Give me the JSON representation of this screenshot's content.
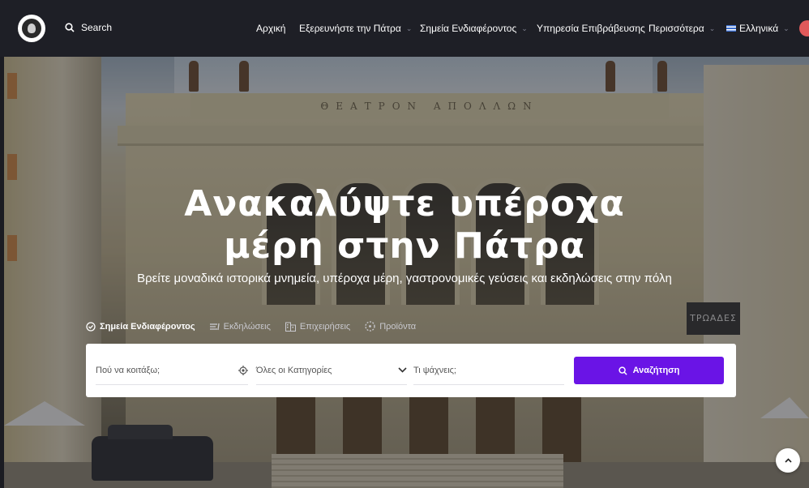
{
  "nav": {
    "search_label": "Search",
    "menu": [
      {
        "label": "Αρχική",
        "dropdown": false
      },
      {
        "label": "Εξερευνήστε την Πάτρα",
        "dropdown": true
      },
      {
        "label": "Σημεία Ενδιαφέροντος",
        "dropdown": true
      },
      {
        "label": "Υπηρεσία Επιβράβευσης",
        "dropdown": false
      },
      {
        "label": "Περισσότερα",
        "dropdown": true
      }
    ],
    "language": "Ελληνικά",
    "caret": "⌄"
  },
  "hero": {
    "building_sign": "ΘΕΑΤΡΟΝ ΑΠΟΛΛΩΝ",
    "shop_sign": "ΤΡΩΑΔΕΣ",
    "title_line1": "Ανακαλύψτε υπέροχα",
    "title_line2": "μέρη στην Πάτρα",
    "subtitle": "Βρείτε μοναδικά ιστορικά μνημεία, υπέροχα μέρη, γαστρονομικές γεύσεις και εκδηλώσεις στην πόλη"
  },
  "tabs": [
    {
      "label": "Σημεία Ενδιαφέροντος",
      "icon": "check-circle-icon",
      "active": true
    },
    {
      "label": "Εκδηλώσεις",
      "icon": "list-icon",
      "active": false
    },
    {
      "label": "Επιχειρήσεις",
      "icon": "building-icon",
      "active": false
    },
    {
      "label": "Προϊόντα",
      "icon": "dotted-circle-icon",
      "active": false
    }
  ],
  "search": {
    "where_placeholder": "Πού να κοιτάξω;",
    "category_value": "Όλες οι Κατηγορίες",
    "what_placeholder": "Τι ψάχνεις;",
    "button_label": "Αναζήτηση"
  },
  "colors": {
    "nav_bg": "#1e1f26",
    "accent": "#6a14e6",
    "avatar": "#e05a5a"
  }
}
